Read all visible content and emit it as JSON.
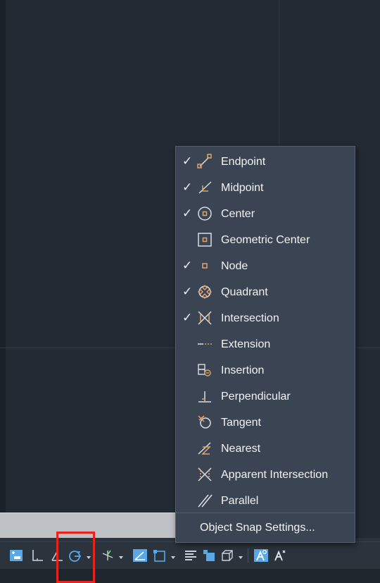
{
  "osnap_menu": {
    "items": [
      {
        "label": "Endpoint",
        "icon": "endpoint-snap-icon",
        "checked": true
      },
      {
        "label": "Midpoint",
        "icon": "midpoint-snap-icon",
        "checked": true
      },
      {
        "label": "Center",
        "icon": "center-snap-icon",
        "checked": true
      },
      {
        "label": "Geometric Center",
        "icon": "geometric-center-snap-icon",
        "checked": false
      },
      {
        "label": "Node",
        "icon": "node-snap-icon",
        "checked": true
      },
      {
        "label": "Quadrant",
        "icon": "quadrant-snap-icon",
        "checked": true
      },
      {
        "label": "Intersection",
        "icon": "intersection-snap-icon",
        "checked": true
      },
      {
        "label": "Extension",
        "icon": "extension-snap-icon",
        "checked": false
      },
      {
        "label": "Insertion",
        "icon": "insertion-snap-icon",
        "checked": false
      },
      {
        "label": "Perpendicular",
        "icon": "perpendicular-snap-icon",
        "checked": false
      },
      {
        "label": "Tangent",
        "icon": "tangent-snap-icon",
        "checked": false
      },
      {
        "label": "Nearest",
        "icon": "nearest-snap-icon",
        "checked": false
      },
      {
        "label": "Apparent Intersection",
        "icon": "apparent-intersection-snap-icon",
        "checked": false
      },
      {
        "label": "Parallel",
        "icon": "parallel-snap-icon",
        "checked": false
      }
    ],
    "settings_label": "Object Snap Settings...",
    "check_glyph": "✓"
  },
  "statusbar": {
    "buttons": [
      "snap-mode-icon",
      "ortho-mode-icon",
      "object-snap-icon",
      "object-snap-tracking-icon",
      "dynamic-ucs-icon",
      "selection-cycling-icon",
      "lineweight-icon",
      "transparency-icon",
      "3d-object-snap-icon",
      "annotation-visibility-icon",
      "auto-scale-icon"
    ],
    "active_color": "#5aa8e6"
  },
  "colors": {
    "menu_bg": "#3b4452",
    "canvas_bg": "#222a33",
    "snap_marker": "#e0a36a",
    "highlight_box": "#e8231d"
  }
}
